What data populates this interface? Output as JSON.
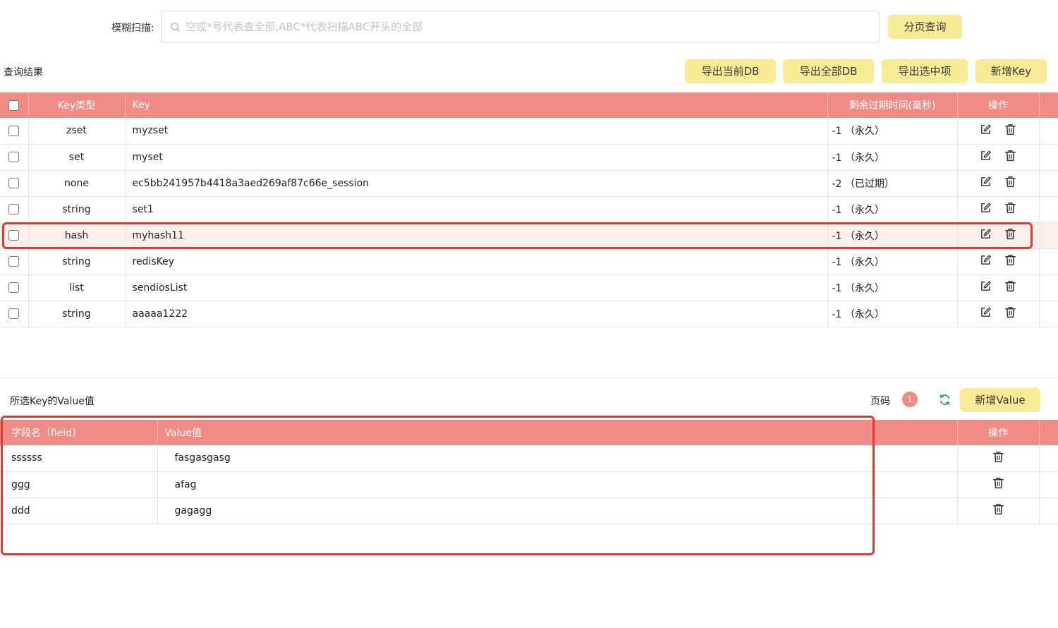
{
  "search": {
    "label": "模糊扫描:",
    "placeholder": "空或*号代表查全部,ABC*代表扫描ABC开头的全部",
    "button": "分页查询"
  },
  "results": {
    "title": "查询结果",
    "buttons": [
      "导出当前DB",
      "导出全部DB",
      "导出选中项",
      "新增Key"
    ],
    "headers": {
      "type": "Key类型",
      "key": "Key",
      "ttl": "剩余过期时间(毫秒)",
      "op": "操作"
    },
    "rows": [
      {
        "type": "zset",
        "key": "myzset",
        "ttl": "-1 （永久）"
      },
      {
        "type": "set",
        "key": "myset",
        "ttl": "-1 （永久）"
      },
      {
        "type": "none",
        "key": "ec5bb241957b4418a3aed269af87c66e_session",
        "ttl": "-2 （已过期）"
      },
      {
        "type": "string",
        "key": "set1",
        "ttl": "-1 （永久）"
      },
      {
        "type": "hash",
        "key": "myhash11",
        "ttl": "-1 （永久）",
        "selected": true
      },
      {
        "type": "string",
        "key": "redisKey",
        "ttl": "-1 （永久）"
      },
      {
        "type": "list",
        "key": "sendiosList",
        "ttl": "-1 （永久）"
      },
      {
        "type": "string",
        "key": "aaaaa1222",
        "ttl": "-1 （永久）"
      }
    ]
  },
  "values": {
    "title": "所选Key的Value值",
    "page_label": "页码",
    "page": "1",
    "add_button": "新增Value",
    "headers": {
      "field": "字段名（field)",
      "value": "Value值",
      "op": "操作"
    },
    "rows": [
      {
        "field": "ssssss",
        "value": "fasgasgasg"
      },
      {
        "field": "ggg",
        "value": "afag"
      },
      {
        "field": "ddd",
        "value": "gagagg"
      }
    ]
  },
  "colors": {
    "header_bg": "#f08c85",
    "button_bg": "#f8eb96",
    "highlight_border": "#e23a30",
    "selected_row_bg": "#fbefe9"
  }
}
